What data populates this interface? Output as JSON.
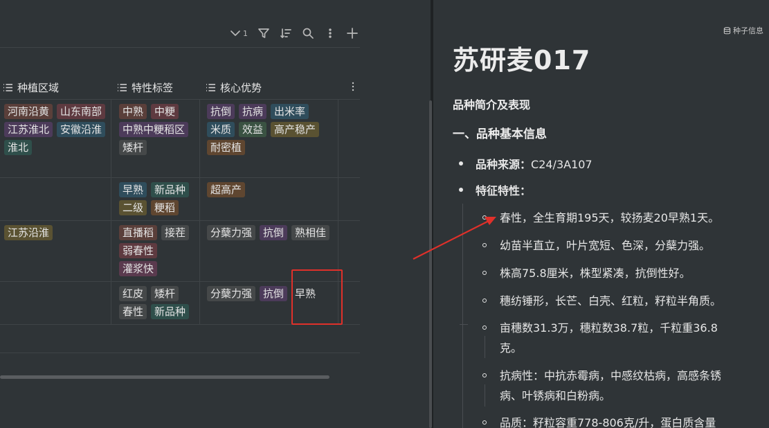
{
  "toolbar": {
    "filter_count": "1"
  },
  "table": {
    "columns": [
      {
        "label": "种植区域"
      },
      {
        "label": "特性标签"
      },
      {
        "label": "核心优势"
      }
    ],
    "rows": [
      {
        "region": [
          {
            "t": "河南沿黄",
            "c": "brown"
          },
          {
            "t": "山东南部",
            "c": "red"
          },
          {
            "t": "江苏淮北",
            "c": "purple"
          },
          {
            "t": "安徽沿淮",
            "c": "blue"
          },
          {
            "t": "淮北",
            "c": "teal"
          }
        ],
        "tags": [
          {
            "t": "中熟",
            "c": "brown"
          },
          {
            "t": "中粳",
            "c": "red"
          },
          {
            "t": "中熟中粳稻区",
            "c": "purple"
          },
          {
            "t": "矮杆",
            "c": "gray"
          }
        ],
        "adv": [
          {
            "t": "抗倒",
            "c": "purple"
          },
          {
            "t": "抗病",
            "c": "purple"
          },
          {
            "t": "出米率",
            "c": "blue"
          },
          {
            "t": "米质",
            "c": "blue"
          },
          {
            "t": "效益",
            "c": "green"
          },
          {
            "t": "高产稳产",
            "c": "yellow"
          },
          {
            "t": "耐密植",
            "c": "orange"
          }
        ]
      },
      {
        "region": [],
        "tags": [
          {
            "t": "早熟",
            "c": "blue"
          },
          {
            "t": "新品种",
            "c": "teal"
          },
          {
            "t": "二级",
            "c": "yellow"
          },
          {
            "t": "粳稻",
            "c": "orange"
          }
        ],
        "adv": [
          {
            "t": "超高产",
            "c": "orange"
          }
        ]
      },
      {
        "region": [
          {
            "t": "江苏沿淮",
            "c": "yellow"
          }
        ],
        "tags": [
          {
            "t": "直播稻",
            "c": "brown"
          },
          {
            "t": "接茬",
            "c": "gray"
          },
          {
            "t": "弱春性",
            "c": "red"
          },
          {
            "t": "灌浆快",
            "c": "pink"
          }
        ],
        "adv": [
          {
            "t": "分蘖力强",
            "c": "gray"
          },
          {
            "t": "抗倒",
            "c": "purple"
          },
          {
            "t": "熟相佳",
            "c": "gray"
          }
        ]
      },
      {
        "region": [],
        "tags": [
          {
            "t": "红皮",
            "c": "gray"
          },
          {
            "t": "矮杆",
            "c": "gray"
          },
          {
            "t": "春性",
            "c": "gray"
          },
          {
            "t": "新品种",
            "c": "teal"
          }
        ],
        "adv": [
          {
            "t": "分蘖力强",
            "c": "gray"
          },
          {
            "t": "抗倒",
            "c": "purple"
          },
          {
            "t": "早熟",
            "c": "none"
          }
        ]
      }
    ]
  },
  "doc": {
    "meta_label": "种子信息",
    "title": "苏研麦017",
    "intro_heading": "品种简介及表现",
    "section_heading": "一、品种基本信息",
    "source_label": "品种来源：",
    "source_value": "C24/3A107",
    "traits_label": "特征特性：",
    "traits": [
      [
        "春性，全生育期195天，较扬麦20早熟1天。"
      ],
      [
        "幼苗半直立，叶片宽短、色深，分蘖力强。"
      ],
      [
        "株高75.8厘米，株型紧凑，抗倒性好。"
      ],
      [
        "穗纺锤形，长芒、白壳、红粒，籽粒半角质。"
      ],
      [
        "亩穗数31.3万，穗粒数38.7粒，千粒重36.8",
        "克。"
      ],
      [
        "抗病性：中抗赤霉病，中感纹枯病，高感条锈",
        "病、叶锈病和白粉病。"
      ],
      [
        "品质：籽粒容重778-806克/升，蛋白质含量"
      ]
    ]
  },
  "colors": {
    "background": "#2f3437",
    "highlight": "#e0302a",
    "arrow": "#e0302a"
  }
}
